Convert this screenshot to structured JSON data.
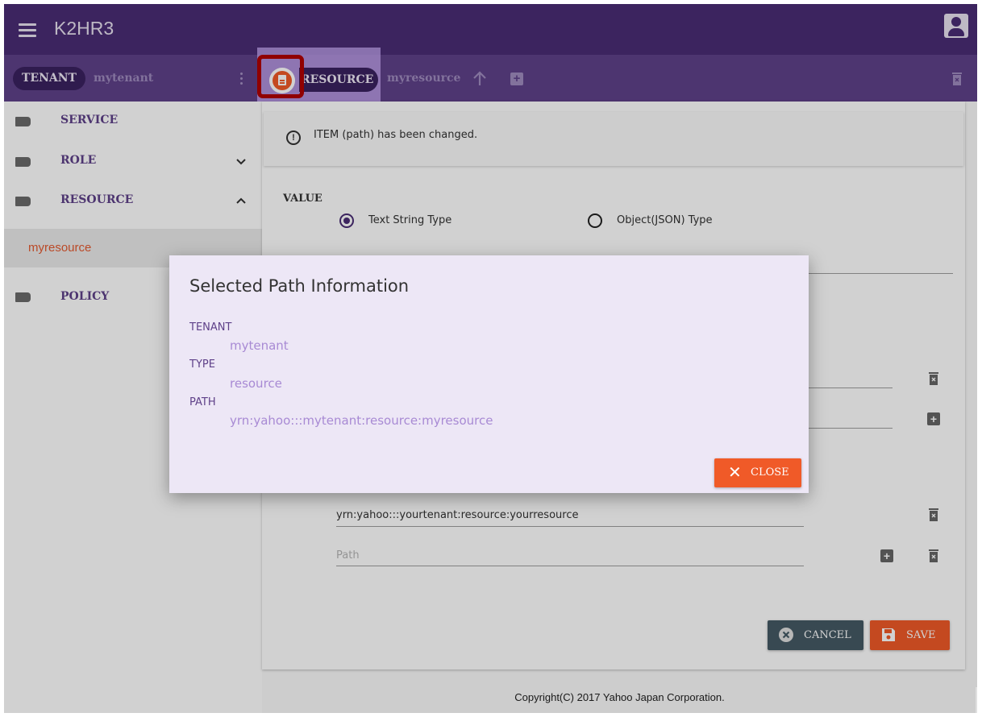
{
  "app": {
    "title": "K2HR3"
  },
  "breadcrumb": {
    "tenant_chip": "TENANT",
    "tenant_name": "mytenant",
    "type_chip": "RESOURCE",
    "resource_name": "myresource"
  },
  "sidebar": {
    "items": [
      {
        "label": "SERVICE"
      },
      {
        "label": "ROLE",
        "chevron": "down"
      },
      {
        "label": "RESOURCE",
        "chevron": "up"
      },
      {
        "label": "POLICY"
      }
    ],
    "sub_items": [
      {
        "label": "myresource"
      }
    ]
  },
  "notice": {
    "text": "ITEM (path) has been changed."
  },
  "value_section": {
    "label": "VALUE",
    "options": [
      "Text String Type",
      "Object(JSON) Type"
    ],
    "selected": "Text String Type"
  },
  "path_fields": {
    "value": "yrn:yahoo:::yourtenant:resource:yourresource",
    "placeholder": "Path"
  },
  "actions": {
    "cancel": "CANCEL",
    "save": "SAVE"
  },
  "footer": {
    "copyright": "Copyright(C) 2017 Yahoo Japan Corporation."
  },
  "dialog": {
    "title": "Selected Path Information",
    "tenant_key": "TENANT",
    "tenant_value": "mytenant",
    "type_key": "TYPE",
    "type_value": "resource",
    "path_key": "PATH",
    "path_value": "yrn:yahoo:::mytenant:resource:myresource",
    "close": "CLOSE"
  },
  "colors": {
    "app_bar": "#4a2c74",
    "breadcrumb_bar": "#5f4189",
    "accent_orange": "#f05a28",
    "dialog_bg": "#ede7f6",
    "annotation_frame": "#b00000"
  },
  "icons": [
    "menu-icon",
    "account-icon",
    "document-icon",
    "arrow-up-icon",
    "add-icon",
    "delete-icon",
    "tag-icon",
    "chevron-down-icon",
    "chevron-up-icon",
    "info-icon",
    "close-icon",
    "cancel-icon",
    "save-icon"
  ]
}
